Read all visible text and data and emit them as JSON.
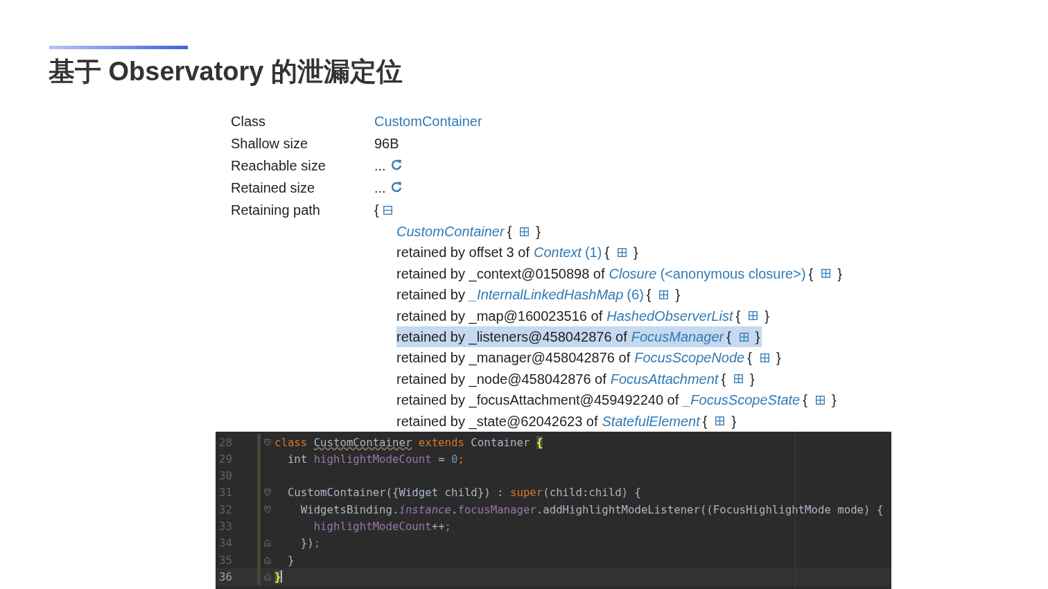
{
  "slide": {
    "title": "基于 Observatory 的泄漏定位"
  },
  "properties": [
    {
      "label": "Class",
      "value": "CustomContainer",
      "kind": "link"
    },
    {
      "label": "Shallow size",
      "value": "96B",
      "kind": "text"
    },
    {
      "label": "Reachable size",
      "value": "...",
      "kind": "refresh"
    },
    {
      "label": "Retained size",
      "value": "...",
      "kind": "refresh"
    },
    {
      "label": "Retaining path",
      "value": "{",
      "kind": "collapse"
    }
  ],
  "retaining_path": [
    {
      "class_name": "CustomContainer",
      "open": "{",
      "close": "}",
      "selected": false
    },
    {
      "prefix": "retained by offset 3 of",
      "class_name": "Context",
      "count": "(1)",
      "open": "{",
      "close": "}",
      "selected": false
    },
    {
      "prefix": "retained by _context@0150898 of",
      "class_name": "Closure",
      "count": "(<anonymous closure>)",
      "open": "{",
      "close": "}",
      "selected": false
    },
    {
      "prefix": "retained by",
      "class_name": "_InternalLinkedHashMap",
      "count": "(6)",
      "open": "{",
      "close": "}",
      "selected": false
    },
    {
      "prefix": "retained by _map@160023516 of",
      "class_name": "HashedObserverList",
      "open": "{",
      "close": "}",
      "selected": false
    },
    {
      "prefix": "retained by _listeners@458042876 of",
      "class_name": "FocusManager",
      "open": "{",
      "close": "}",
      "selected": true
    },
    {
      "prefix": "retained by _manager@458042876 of",
      "class_name": "FocusScopeNode",
      "open": "{",
      "close": "}",
      "selected": false
    },
    {
      "prefix": "retained by _node@458042876 of",
      "class_name": "FocusAttachment",
      "open": "{",
      "close": "}",
      "selected": false
    },
    {
      "prefix": "retained by _focusAttachment@459492240 of",
      "class_name": "_FocusScopeState",
      "open": "{",
      "close": "}",
      "selected": false
    },
    {
      "prefix": "retained by _state@62042623 of",
      "class_name": "StatefulElement",
      "open": "{",
      "close": "}",
      "selected": false
    }
  ],
  "code_editor": {
    "lines": [
      {
        "number": "28",
        "fold_start": true,
        "fold_end": false,
        "current": false,
        "tokens": [
          {
            "kind": "keyword",
            "text": "class "
          },
          {
            "kind": "warning",
            "text": "CustomContainer"
          },
          {
            "kind": "keyword",
            "text": " extends"
          },
          {
            "kind": "plain",
            "text": " Container "
          },
          {
            "kind": "match",
            "text": "{"
          }
        ]
      },
      {
        "number": "29",
        "fold_start": false,
        "fold_end": false,
        "current": false,
        "tokens": [
          {
            "kind": "plain",
            "text": "  int "
          },
          {
            "kind": "field",
            "text": "highlightModeCount"
          },
          {
            "kind": "plain",
            "text": " = "
          },
          {
            "kind": "number",
            "text": "0"
          },
          {
            "kind": "keyword",
            "text": ";"
          }
        ]
      },
      {
        "number": "30",
        "fold_start": false,
        "fold_end": false,
        "current": false
      },
      {
        "number": "31",
        "fold_start": true,
        "fold_end": false,
        "current": false,
        "tokens": [
          {
            "kind": "plain",
            "text": "  CustomContainer({Widget child}) : "
          },
          {
            "kind": "keyword",
            "text": "super"
          },
          {
            "kind": "plain",
            "text": "(child:child) {"
          }
        ]
      },
      {
        "number": "32",
        "fold_start": true,
        "fold_end": false,
        "current": false,
        "tokens": [
          {
            "kind": "plain",
            "text": "    WidgetsBinding."
          },
          {
            "kind": "static",
            "text": "instance"
          },
          {
            "kind": "plain",
            "text": "."
          },
          {
            "kind": "field",
            "text": "focusManager"
          },
          {
            "kind": "plain",
            "text": ".addHighlightModeListener((FocusHighlightMode mode) {"
          }
        ]
      },
      {
        "number": "33",
        "fold_start": false,
        "fold_end": false,
        "current": false,
        "tokens": [
          {
            "kind": "field",
            "text": "      highlightModeCount"
          },
          {
            "kind": "plain",
            "text": "++"
          },
          {
            "kind": "keyword",
            "text": ";"
          }
        ]
      },
      {
        "number": "34",
        "fold_start": false,
        "fold_end": true,
        "current": false,
        "tokens": [
          {
            "kind": "plain",
            "text": "    })"
          },
          {
            "kind": "keyword",
            "text": ";"
          }
        ]
      },
      {
        "number": "35",
        "fold_start": false,
        "fold_end": true,
        "current": false,
        "tokens": [
          {
            "kind": "plain",
            "text": "  }"
          }
        ]
      },
      {
        "number": "36",
        "fold_start": false,
        "fold_end": true,
        "current": true,
        "tokens": [
          {
            "kind": "match",
            "text": "}"
          }
        ]
      }
    ]
  }
}
